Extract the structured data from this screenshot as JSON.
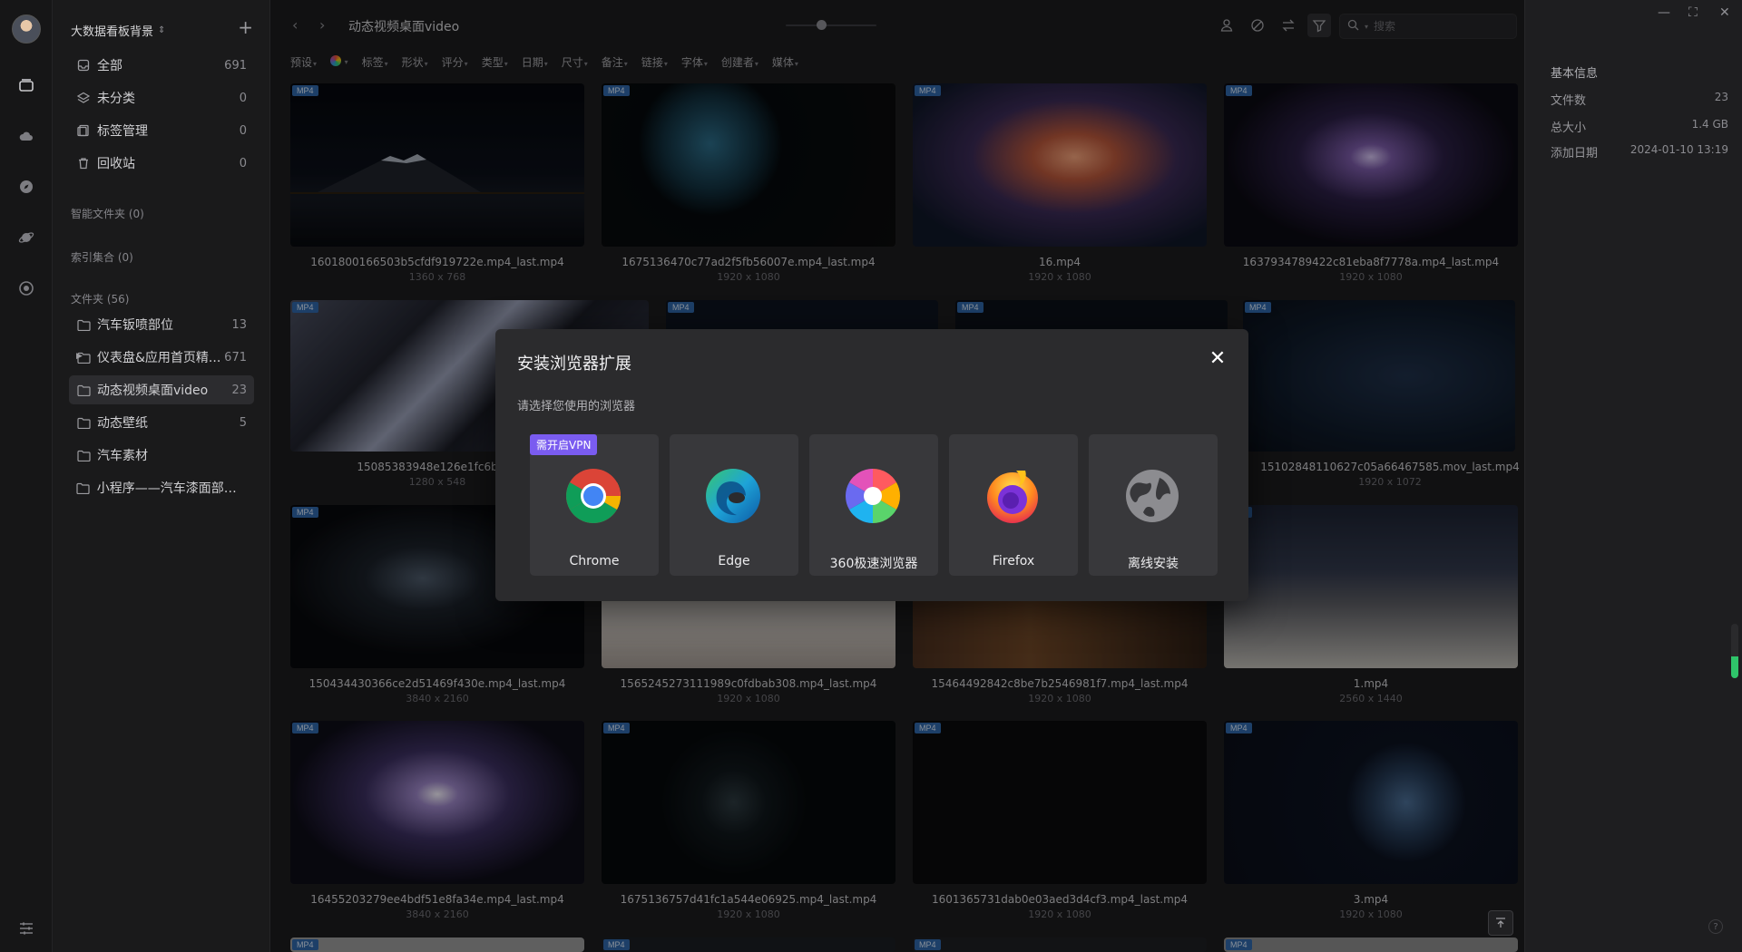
{
  "library": {
    "name": "大数据看板背景",
    "add": "+"
  },
  "nav": [
    {
      "label": "全部",
      "count": "691",
      "icon": "inbox-icon"
    },
    {
      "label": "未分类",
      "count": "0",
      "icon": "layers-icon"
    },
    {
      "label": "标签管理",
      "count": "0",
      "icon": "tags-icon"
    },
    {
      "label": "回收站",
      "count": "0",
      "icon": "trash-icon"
    }
  ],
  "sections": {
    "smart": "智能文件夹 (0)",
    "index": "索引集合 (0)",
    "folders": "文件夹 (56)"
  },
  "folders": [
    {
      "label": "汽车钣喷部位",
      "count": "13"
    },
    {
      "label": "仪表盘&应用首页精...",
      "count": "671"
    },
    {
      "label": "动态视频桌面video",
      "count": "23"
    },
    {
      "label": "动态壁纸",
      "count": "5"
    },
    {
      "label": "汽车素材",
      "count": ""
    },
    {
      "label": "小程序——汽车漆面部位...",
      "count": ""
    }
  ],
  "topbar": {
    "breadcrumb": "动态视频桌面video",
    "search_placeholder": "搜索"
  },
  "filters": [
    "预设",
    "标签",
    "形状",
    "评分",
    "类型",
    "日期",
    "尺寸",
    "备注",
    "链接",
    "字体",
    "创建者",
    "媒体"
  ],
  "badge_label": "MP4",
  "files": [
    {
      "name": "1601800166503b5cfdf919722e.mp4_last.mp4",
      "dim": "1360 x 768"
    },
    {
      "name": "1675136470c77ad2f5fb56007e.mp4_last.mp4",
      "dim": "1920 x 1080"
    },
    {
      "name": "16.mp4",
      "dim": "1920 x 1080"
    },
    {
      "name": "1637934789422c81eba8f7778a.mp4_last.mp4",
      "dim": "1920 x 1080"
    },
    {
      "name": "15085383948e126e1fc6b22c",
      "dim": "1280 x 548"
    },
    {
      "name": "15102848110627c05a66467585.mov_last.mp4",
      "dim": "1920 x 1072"
    },
    {
      "name": "150434430366ce2d51469f430e.mp4_last.mp4",
      "dim": "3840 x 2160"
    },
    {
      "name": "1565245273111989c0fdbab308.mp4_last.mp4",
      "dim": "1920 x 1080"
    },
    {
      "name": "15464492842c8be7b2546981f7.mp4_last.mp4",
      "dim": "1920 x 1080"
    },
    {
      "name": "1.mp4",
      "dim": "2560 x 1440"
    },
    {
      "name": "16455203279ee4bdf51e8fa34e.mp4_last.mp4",
      "dim": "3840 x 2160"
    },
    {
      "name": "1675136757d41fc1a544e06925.mp4_last.mp4",
      "dim": "1920 x 1080"
    },
    {
      "name": "1601365731dab0e03aed3d4cf3.mp4_last.mp4",
      "dim": "1920 x 1080"
    },
    {
      "name": "3.mp4",
      "dim": "1920 x 1080"
    }
  ],
  "info": {
    "title": "基本信息",
    "rows": [
      {
        "k": "文件数",
        "v": "23"
      },
      {
        "k": "总大小",
        "v": "1.4 GB"
      },
      {
        "k": "添加日期",
        "v": "2024-01-10 13:19"
      }
    ]
  },
  "modal": {
    "title": "安装浏览器扩展",
    "subtitle": "请选择您使用的浏览器",
    "close": "✕",
    "vpn_badge": "需开启VPN",
    "browsers": [
      "Chrome",
      "Edge",
      "360极速浏览器",
      "Firefox",
      "离线安装"
    ]
  },
  "help": "?"
}
